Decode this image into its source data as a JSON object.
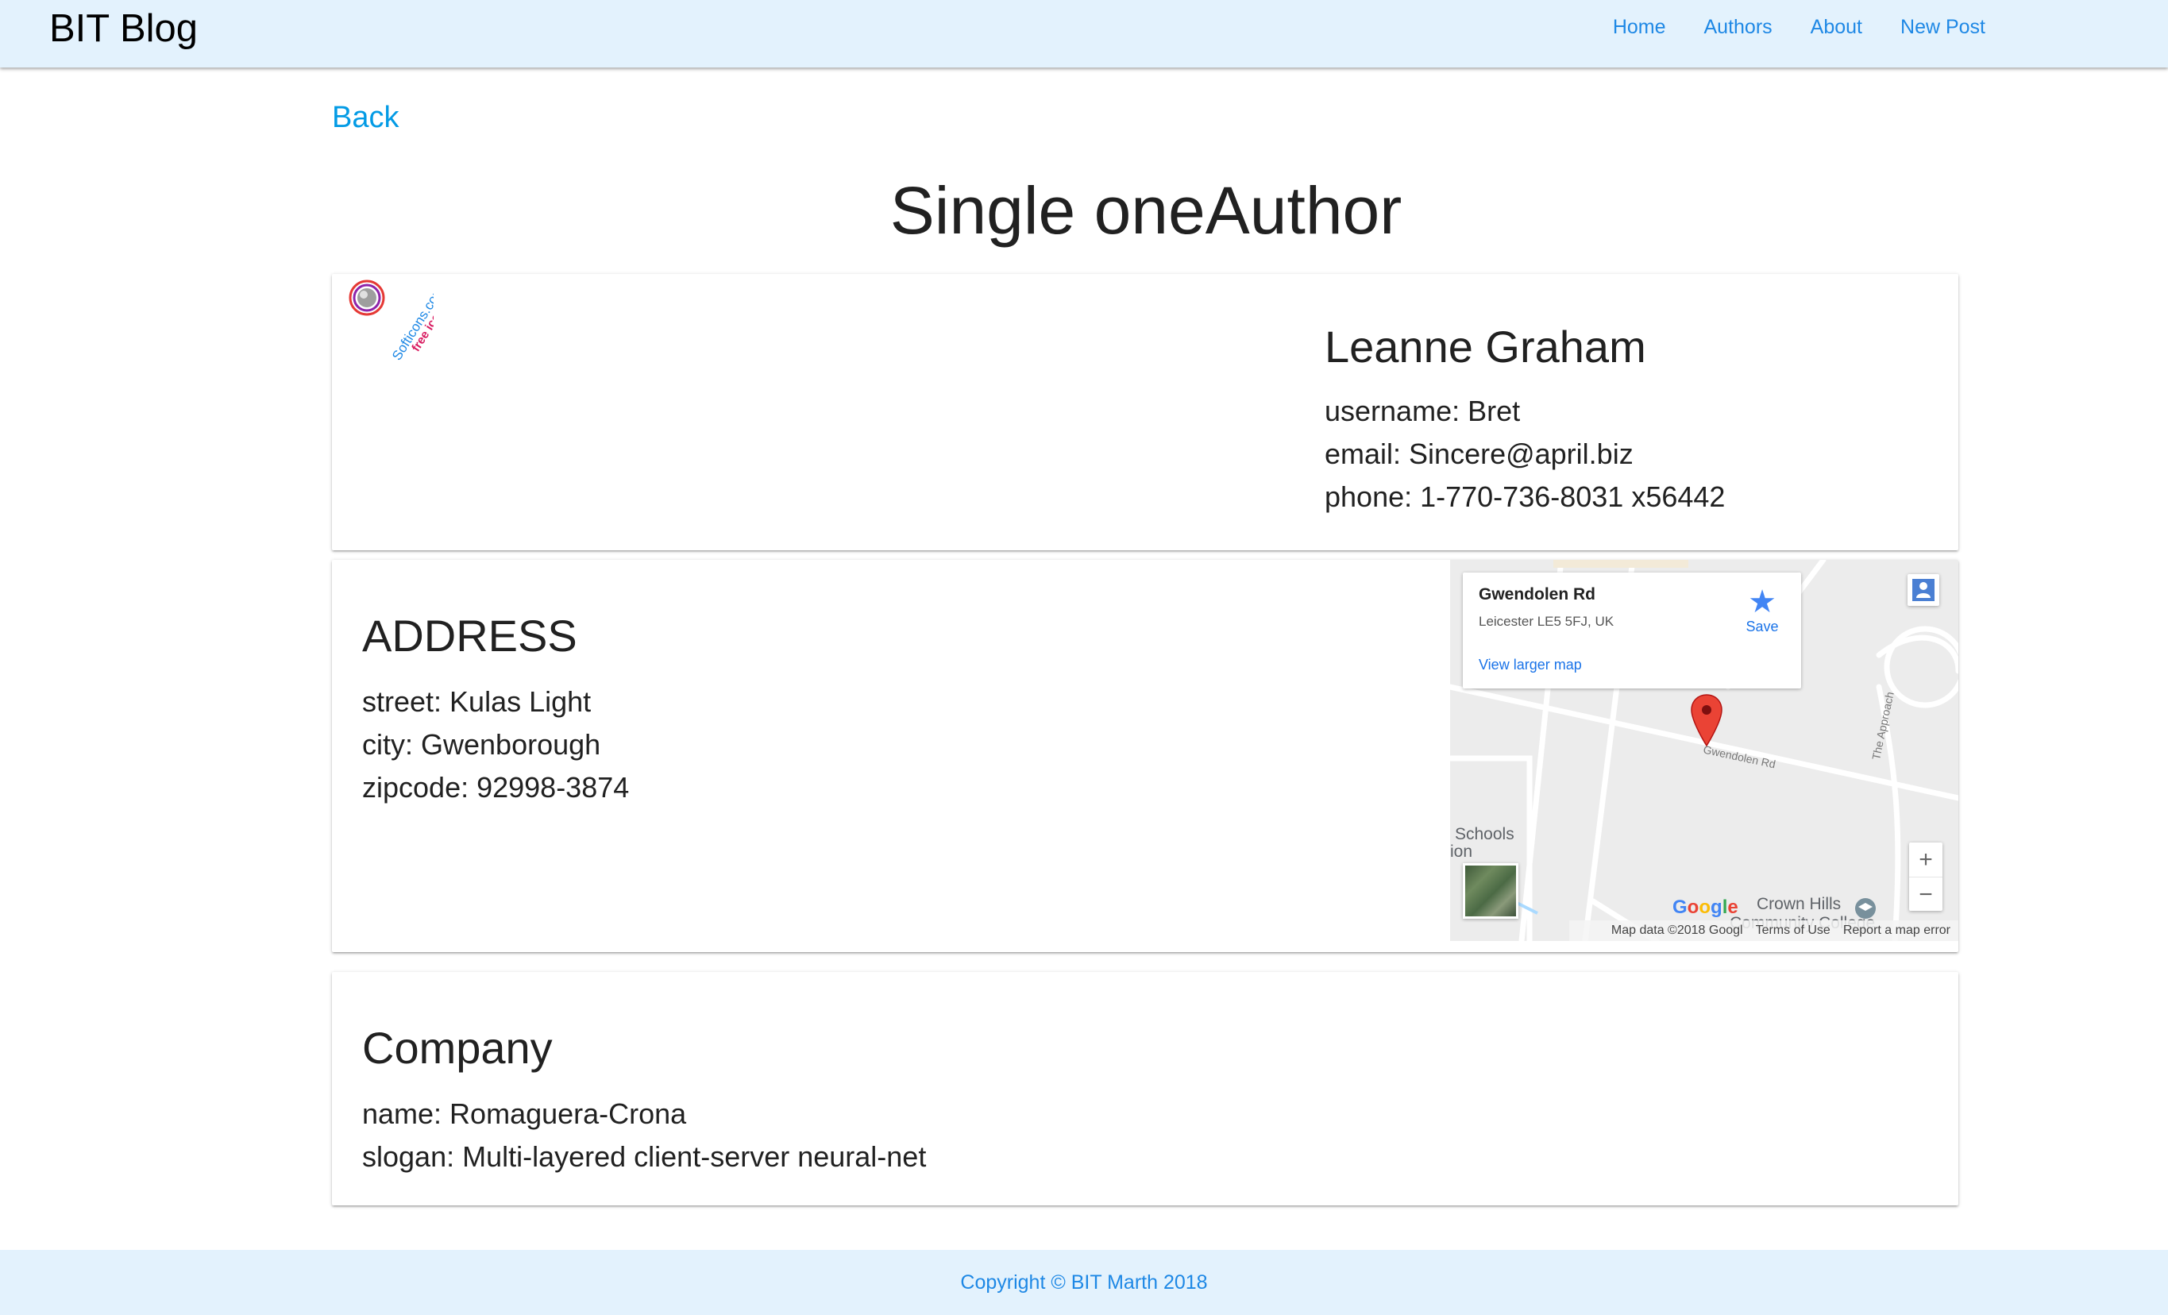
{
  "navbar": {
    "brand": "BIT Blog",
    "links": [
      "Home",
      "Authors",
      "About",
      "New Post"
    ]
  },
  "back_label": "Back",
  "page_title": "Single oneAuthor",
  "author": {
    "name": "Leanne Graham",
    "username": "username: Bret",
    "email": "email: Sincere@april.biz",
    "phone": "phone: 1-770-736-8031 x56442"
  },
  "address": {
    "title": "ADDRESS",
    "street": "street: Kulas Light",
    "city": "city: Gwenborough",
    "zipcode": "zipcode: 92998-3874"
  },
  "map": {
    "place_name": "Gwendolen Rd",
    "place_address": "Leicester LE5 5FJ, UK",
    "view_larger": "View larger map",
    "save_label": "Save",
    "label_schools": "Schools",
    "label_partial": "ion",
    "label_crown": "Crown Hills",
    "label_college": "Community College",
    "road_gwendolen": "Gwendolen Rd",
    "road_approach": "The Approach",
    "google": "Google",
    "footer_data": "Map data ©2018 Googl",
    "footer_terms": "Terms of Use",
    "footer_report": "Report a map error",
    "zoom_in": "+",
    "zoom_out": "−"
  },
  "company": {
    "title": "Company",
    "name": "name: Romaguera-Crona",
    "slogan": "slogan: Multi-layered client-server neural-net"
  },
  "footer": "Copyright © BIT Marth 2018"
}
